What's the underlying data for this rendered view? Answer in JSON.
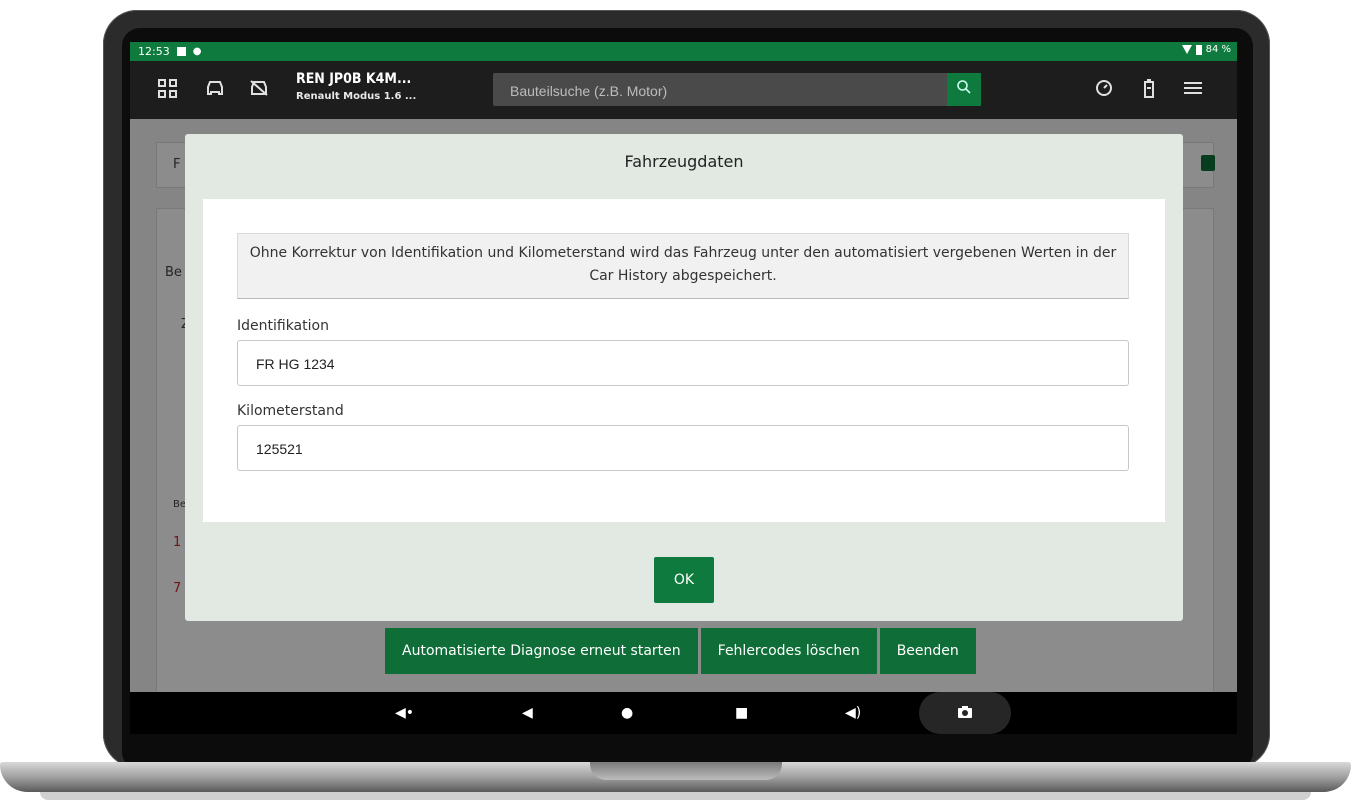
{
  "status_bar": {
    "time": "12:53",
    "battery": "84 %"
  },
  "header": {
    "vehicle_title": "REN JP0B K4M...",
    "vehicle_subtitle": "Renault Modus 1.6 ...",
    "search_placeholder": "Bauteilsuche (z.B. Motor)"
  },
  "background": {
    "frag_1": "F",
    "frag_2": "Be",
    "frag_3": "Z",
    "frag_4": "Be",
    "frag_5": "1",
    "frag_6": "7",
    "actions": [
      "Automatisierte Diagnose erneut starten",
      "Fehlercodes löschen",
      "Beenden"
    ]
  },
  "modal": {
    "title": "Fahrzeugdaten",
    "info_text": "Ohne Korrektur von Identifikation und Kilometerstand wird das Fahrzeug unter den automatisiert vergebenen Werten in der Car History abgespeichert.",
    "id_label": "Identifikation",
    "id_value": "FR HG 1234",
    "km_label": "Kilometerstand",
    "km_value": "125521",
    "ok_label": "OK"
  },
  "icons": {
    "status": [
      "image-icon",
      "android-icon",
      "wifi-icon",
      "battery-icon"
    ],
    "topbar": [
      "dashboard-grid-icon",
      "car-icon",
      "car-off-icon",
      "search-icon",
      "gauge-icon",
      "battery-icon",
      "menu-icon"
    ],
    "navbar": [
      "volume-down-icon",
      "back-icon",
      "home-icon",
      "recents-icon",
      "volume-up-icon",
      "camera-icon"
    ]
  },
  "colors": {
    "accent_green": "#0f7a3e",
    "topbar_dark": "#1d1d1d",
    "modal_bg": "#e1e9e2"
  }
}
